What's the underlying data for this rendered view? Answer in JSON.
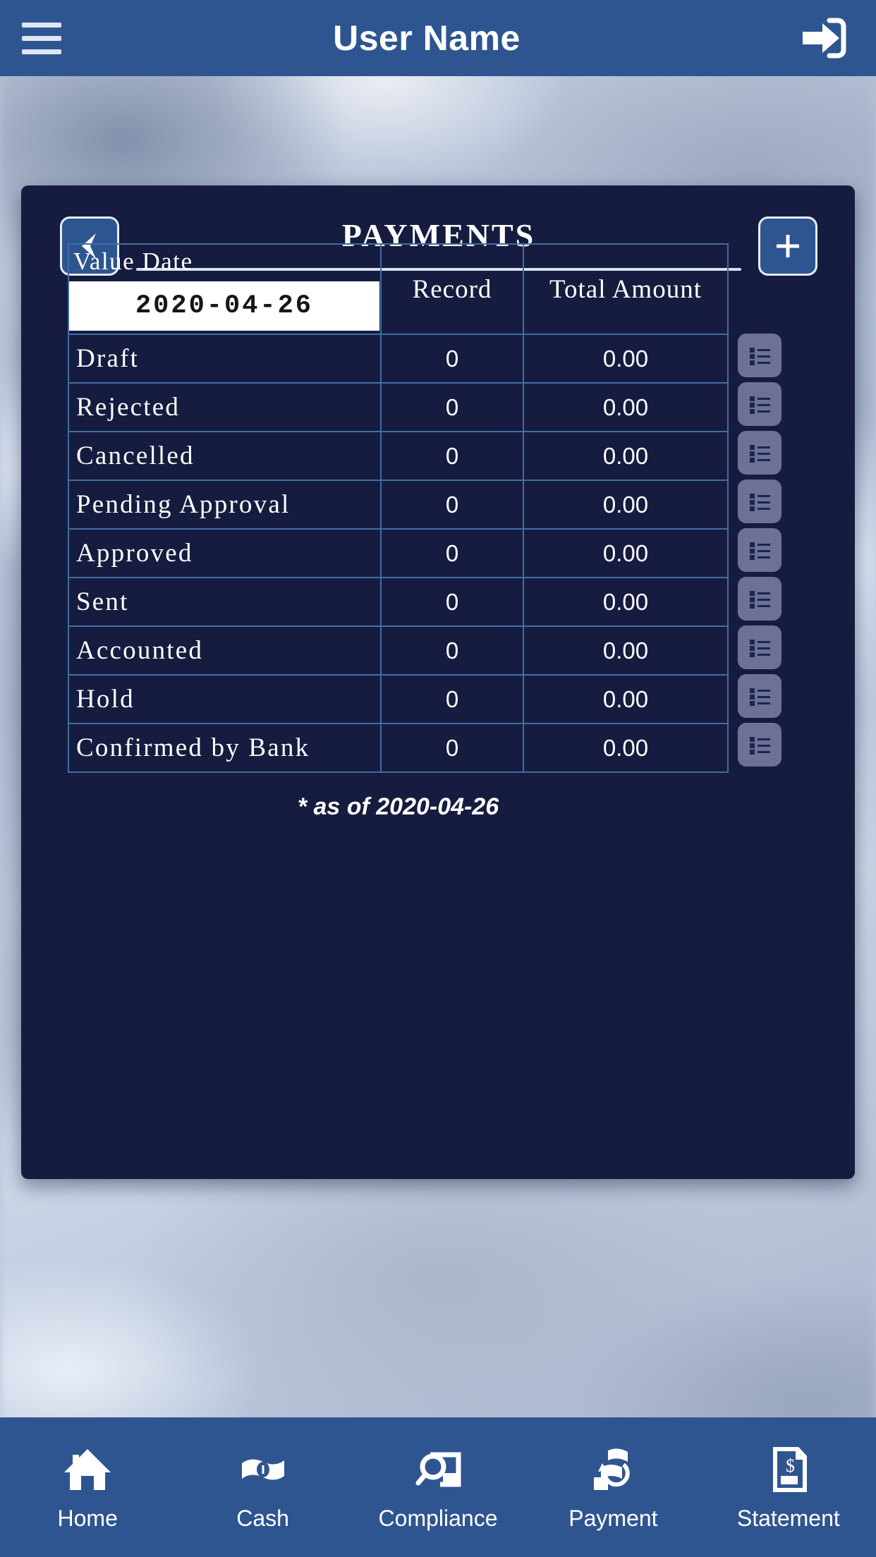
{
  "topbar": {
    "menu_icon": "hamburger-menu-icon",
    "title": "User Name",
    "logout_icon": "logout-icon"
  },
  "card": {
    "back_icon": "back-arrow-icon",
    "title": "PAYMENTS",
    "add_icon": "plus-icon",
    "value_date_label": "Value Date",
    "value_date_value": "2020-04-26",
    "columns": [
      "Record",
      "Total Amount"
    ],
    "rows": [
      {
        "label": "Draft",
        "record": "0",
        "amount": "0.00",
        "action_icon": "list-icon"
      },
      {
        "label": "Rejected",
        "record": "0",
        "amount": "0.00",
        "action_icon": "list-icon"
      },
      {
        "label": "Cancelled",
        "record": "0",
        "amount": "0.00",
        "action_icon": "list-icon"
      },
      {
        "label": "Pending Approval",
        "record": "0",
        "amount": "0.00",
        "action_icon": "list-icon"
      },
      {
        "label": "Approved",
        "record": "0",
        "amount": "0.00",
        "action_icon": "list-icon"
      },
      {
        "label": "Sent",
        "record": "0",
        "amount": "0.00",
        "action_icon": "list-icon"
      },
      {
        "label": "Accounted",
        "record": "0",
        "amount": "0.00",
        "action_icon": "list-icon"
      },
      {
        "label": "Hold",
        "record": "0",
        "amount": "0.00",
        "action_icon": "list-icon"
      },
      {
        "label": "Confirmed by Bank",
        "record": "0",
        "amount": "0.00",
        "action_icon": "list-icon"
      }
    ],
    "as_of_note": "* as of 2020-04-26"
  },
  "bottom_nav": {
    "items": [
      {
        "label": "Home",
        "icon": "home-icon"
      },
      {
        "label": "Cash",
        "icon": "banknote-icon"
      },
      {
        "label": "Compliance",
        "icon": "magnifier-document-icon"
      },
      {
        "label": "Payment",
        "icon": "money-transfer-icon"
      },
      {
        "label": "Statement",
        "icon": "document-dollar-icon"
      }
    ]
  },
  "colors": {
    "topbar_blue": "#2f5591",
    "card_navy": "#161c3f",
    "table_border": "#3f6ea3",
    "list_button": "#6d7195",
    "text_white": "#ffffff"
  }
}
